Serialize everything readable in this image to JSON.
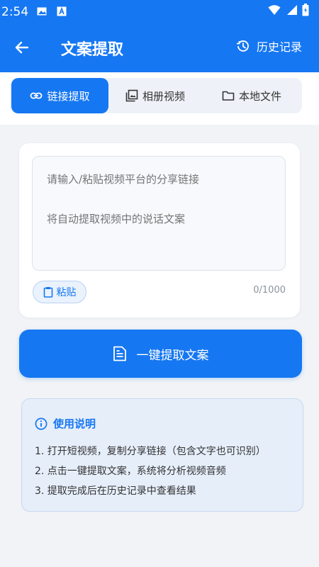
{
  "status_bar": {
    "time": "2:54"
  },
  "app_bar": {
    "title": "文案提取",
    "history_label": "历史记录"
  },
  "tabs": [
    {
      "label": "链接提取",
      "icon": "link-icon",
      "active": true
    },
    {
      "label": "相册视频",
      "icon": "photo-library-icon",
      "active": false
    },
    {
      "label": "本地文件",
      "icon": "folder-icon",
      "active": false
    }
  ],
  "input": {
    "placeholder": "请输入/粘贴视频平台的分享链接\n\n将自动提取视频中的说话文案",
    "value": "",
    "counter": "0/1000",
    "paste_label": "粘贴"
  },
  "primary_button": {
    "label": "一键提取文案"
  },
  "instructions": {
    "title": "使用说明",
    "items": [
      "1. 打开短视频，复制分享链接（包含文字也可识别）",
      "2. 点击一键提取文案，系统将分析视频音频",
      "3. 提取完成后在历史记录中查看结果"
    ]
  },
  "colors": {
    "primary": "#1677f2",
    "background": "#f1f3f7",
    "info_bg": "#e6eefa"
  }
}
